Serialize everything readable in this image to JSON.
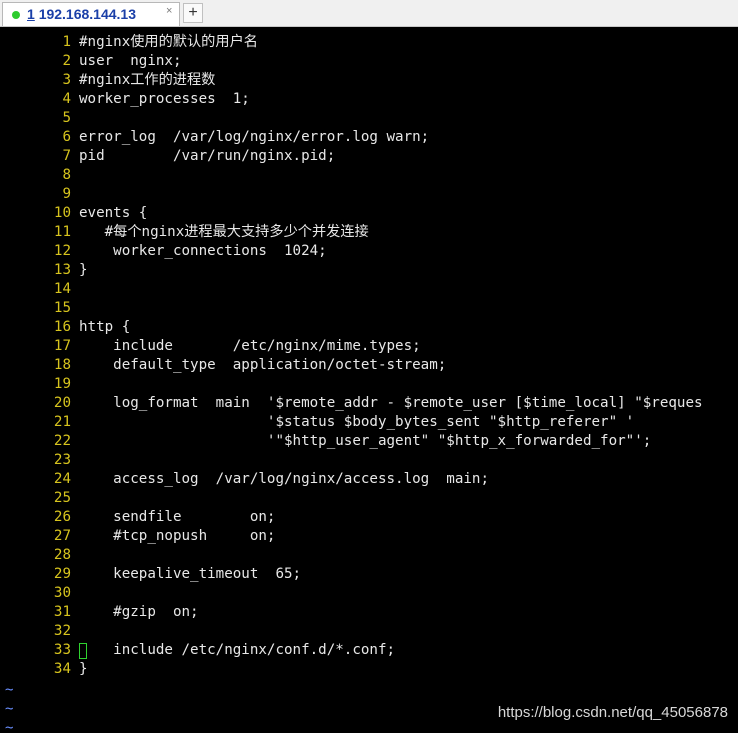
{
  "tab": {
    "index": "1",
    "title": "192.168.144.13",
    "close_icon": "×",
    "add_icon": "+",
    "status_color": "#2ecc2e"
  },
  "editor": {
    "lines": [
      {
        "num": "1",
        "text": "#nginx使用的默认的用户名"
      },
      {
        "num": "2",
        "text": "user  nginx;"
      },
      {
        "num": "3",
        "text": "#nginx工作的进程数"
      },
      {
        "num": "4",
        "text": "worker_processes  1;"
      },
      {
        "num": "5",
        "text": ""
      },
      {
        "num": "6",
        "text": "error_log  /var/log/nginx/error.log warn;"
      },
      {
        "num": "7",
        "text": "pid        /var/run/nginx.pid;"
      },
      {
        "num": "8",
        "text": ""
      },
      {
        "num": "9",
        "text": ""
      },
      {
        "num": "10",
        "text": "events {"
      },
      {
        "num": "11",
        "text": "   #每个nginx进程最大支持多少个并发连接"
      },
      {
        "num": "12",
        "text": "    worker_connections  1024;"
      },
      {
        "num": "13",
        "text": "}"
      },
      {
        "num": "14",
        "text": ""
      },
      {
        "num": "15",
        "text": ""
      },
      {
        "num": "16",
        "text": "http {"
      },
      {
        "num": "17",
        "text": "    include       /etc/nginx/mime.types;"
      },
      {
        "num": "18",
        "text": "    default_type  application/octet-stream;"
      },
      {
        "num": "19",
        "text": ""
      },
      {
        "num": "20",
        "text": "    log_format  main  '$remote_addr - $remote_user [$time_local] \"$reques"
      },
      {
        "num": "21",
        "text": "                      '$status $body_bytes_sent \"$http_referer\" '"
      },
      {
        "num": "22",
        "text": "                      '\"$http_user_agent\" \"$http_x_forwarded_for\"';"
      },
      {
        "num": "23",
        "text": ""
      },
      {
        "num": "24",
        "text": "    access_log  /var/log/nginx/access.log  main;"
      },
      {
        "num": "25",
        "text": ""
      },
      {
        "num": "26",
        "text": "    sendfile        on;"
      },
      {
        "num": "27",
        "text": "    #tcp_nopush     on;"
      },
      {
        "num": "28",
        "text": ""
      },
      {
        "num": "29",
        "text": "    keepalive_timeout  65;"
      },
      {
        "num": "30",
        "text": ""
      },
      {
        "num": "31",
        "text": "    #gzip  on;"
      },
      {
        "num": "32",
        "text": ""
      },
      {
        "num": "33",
        "text": "    include /etc/nginx/conf.d/*.conf;"
      },
      {
        "num": "34",
        "text": "}"
      }
    ],
    "tilde_lines": [
      "~",
      "~",
      "~"
    ],
    "line_number_color": "#d7c41e",
    "text_color": "#e8e8e8",
    "tilde_color": "#6a8fff"
  },
  "watermark": "https://blog.csdn.net/qq_45056878"
}
